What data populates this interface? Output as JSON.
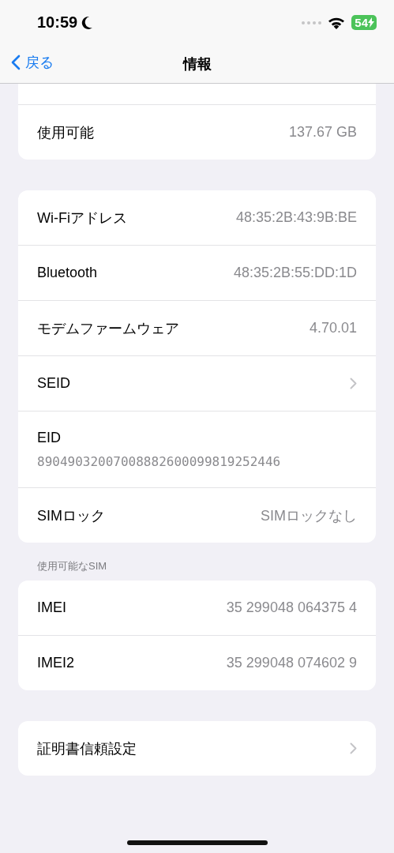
{
  "status_bar": {
    "time": "10:59",
    "battery_text": "54",
    "charging": true
  },
  "nav": {
    "back": "戻る",
    "title": "情報"
  },
  "sections": [
    {
      "continued": true,
      "rows": [
        {
          "kind": "value",
          "label": "使用可能",
          "value": "137.67 GB"
        }
      ]
    },
    {
      "rows": [
        {
          "kind": "value",
          "label": "Wi-Fiアドレス",
          "value": "48:35:2B:43:9B:BE"
        },
        {
          "kind": "value",
          "label": "Bluetooth",
          "value": "48:35:2B:55:DD:1D"
        },
        {
          "kind": "value",
          "label": "モデムファームウェア",
          "value": "4.70.01"
        },
        {
          "kind": "link",
          "label": "SEID"
        },
        {
          "kind": "stacked",
          "label": "EID",
          "value": "89049032007008882600099819252446"
        },
        {
          "kind": "value",
          "label": "SIMロック",
          "value": "SIMロックなし"
        }
      ]
    },
    {
      "header": "使用可能なSIM",
      "rows": [
        {
          "kind": "value",
          "label": "IMEI",
          "value": "35 299048 064375 4"
        },
        {
          "kind": "value",
          "label": "IMEI2",
          "value": "35 299048 074602 9"
        }
      ]
    },
    {
      "rows": [
        {
          "kind": "link",
          "label": "証明書信頼設定"
        }
      ]
    }
  ]
}
